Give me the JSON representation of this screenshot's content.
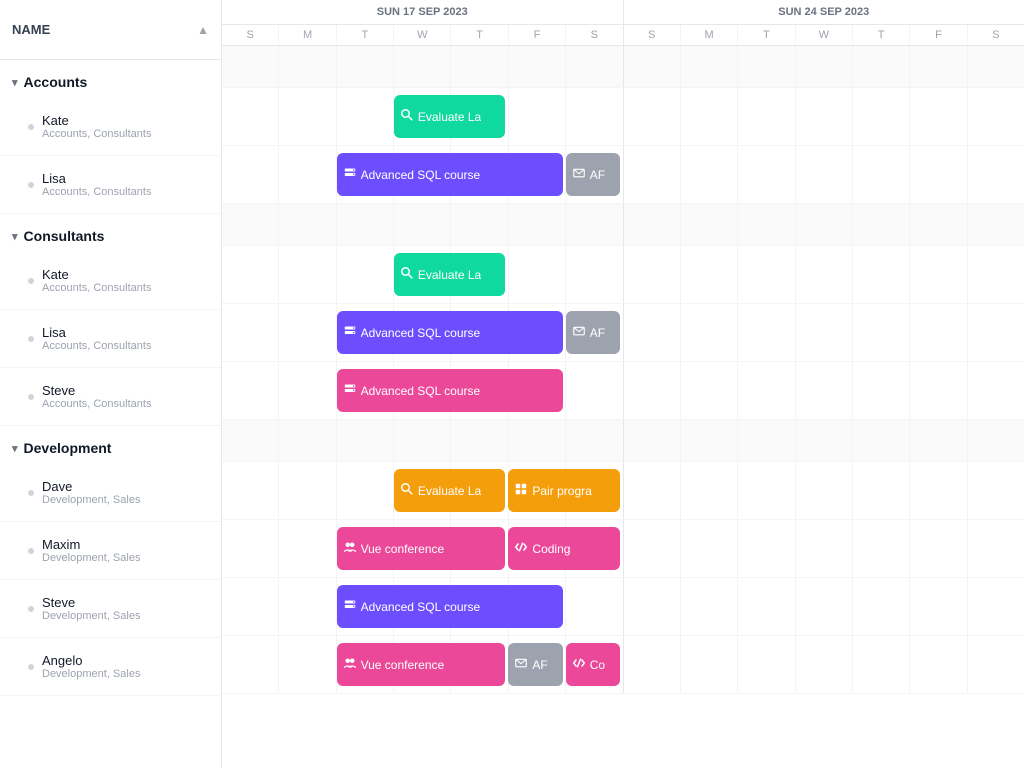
{
  "sidebar": {
    "name_label": "NAME",
    "groups": [
      {
        "id": "accounts",
        "label": "Accounts",
        "expanded": true,
        "members": [
          {
            "name": "Kate",
            "roles": "Accounts, Consultants"
          },
          {
            "name": "Lisa",
            "roles": "Accounts, Consultants"
          }
        ]
      },
      {
        "id": "consultants",
        "label": "Consultants",
        "expanded": true,
        "members": [
          {
            "name": "Kate",
            "roles": "Accounts, Consultants"
          },
          {
            "name": "Lisa",
            "roles": "Accounts, Consultants"
          },
          {
            "name": "Steve",
            "roles": "Accounts, Consultants"
          }
        ]
      },
      {
        "id": "development",
        "label": "Development",
        "expanded": true,
        "members": [
          {
            "name": "Dave",
            "roles": "Development, Sales"
          },
          {
            "name": "Maxim",
            "roles": "Development, Sales"
          },
          {
            "name": "Steve",
            "roles": "Development, Sales"
          },
          {
            "name": "Angelo",
            "roles": "Development, Sales"
          }
        ]
      }
    ]
  },
  "header": {
    "week1": "SUN 17 SEP 2023",
    "week2": "SUN 24 SEP 2023",
    "days": [
      "S",
      "M",
      "T",
      "W",
      "T",
      "F",
      "S",
      "S",
      "M",
      "T",
      "W",
      "T",
      "F",
      "S"
    ]
  },
  "events": {
    "kate_accounts": [
      {
        "label": "Evaluate La",
        "color": "ev-green",
        "icon": "🔍",
        "col_start": 4,
        "col_span": 2
      }
    ],
    "lisa_accounts": [
      {
        "label": "Advanced SQL course",
        "color": "ev-purple",
        "icon": "🗄",
        "col_start": 3,
        "col_span": 4
      },
      {
        "label": "AF",
        "color": "ev-gray",
        "icon": "✉",
        "col_start": 7,
        "col_span": 1
      }
    ],
    "kate_consultants": [
      {
        "label": "Evaluate La",
        "color": "ev-green",
        "icon": "🔍",
        "col_start": 4,
        "col_span": 2
      }
    ],
    "lisa_consultants": [
      {
        "label": "Advanced SQL course",
        "color": "ev-purple",
        "icon": "🗄",
        "col_start": 3,
        "col_span": 4
      },
      {
        "label": "AF",
        "color": "ev-gray",
        "icon": "✉",
        "col_start": 7,
        "col_span": 1
      }
    ],
    "steve_consultants": [
      {
        "label": "Advanced SQL course",
        "color": "ev-pink",
        "icon": "🗄",
        "col_start": 3,
        "col_span": 4
      }
    ],
    "dave_development": [
      {
        "label": "Evaluate La",
        "color": "ev-orange",
        "icon": "🔍",
        "col_start": 4,
        "col_span": 2
      },
      {
        "label": "Pair progra",
        "color": "ev-orange",
        "icon": "⊞",
        "col_start": 6,
        "col_span": 2
      }
    ],
    "maxim_development": [
      {
        "label": "Vue conference",
        "color": "ev-pink",
        "icon": "👥",
        "col_start": 3,
        "col_span": 3
      },
      {
        "label": "Coding",
        "color": "ev-pink",
        "icon": "</>",
        "col_start": 6,
        "col_span": 2
      }
    ],
    "steve_development": [
      {
        "label": "Advanced SQL course",
        "color": "ev-purple",
        "icon": "🗄",
        "col_start": 3,
        "col_span": 4
      }
    ],
    "angelo_development": [
      {
        "label": "Vue conference",
        "color": "ev-pink",
        "icon": "👥",
        "col_start": 3,
        "col_span": 3
      },
      {
        "label": "AF",
        "color": "ev-gray",
        "icon": "✉",
        "col_start": 6,
        "col_span": 1
      },
      {
        "label": "Co",
        "color": "ev-pink",
        "icon": "</>",
        "col_start": 7,
        "col_span": 1
      }
    ]
  },
  "colors": {
    "ev-green": "#10d9a0",
    "ev-purple": "#6c4eff",
    "ev-gray": "#9ca3af",
    "ev-orange": "#f59e0b",
    "ev-pink": "#ec4899"
  }
}
